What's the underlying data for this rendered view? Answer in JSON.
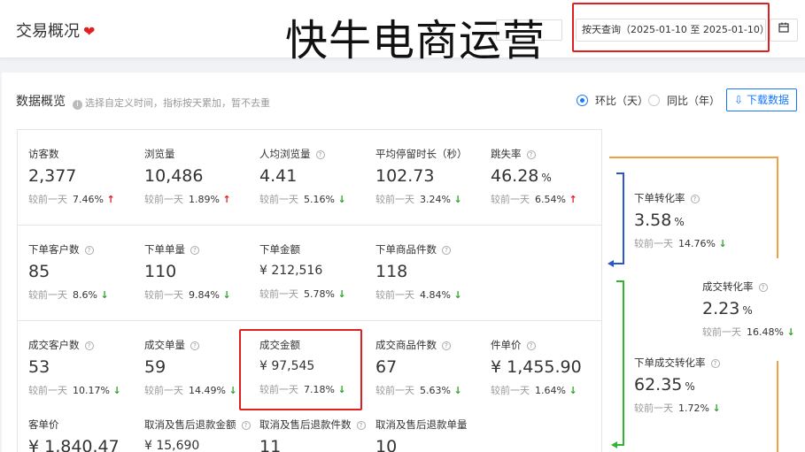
{
  "header": {
    "title": "交易概况",
    "watermark": "快牛电商运营",
    "date_button": "按天查询（2025-01-10 至 2025-01-10）",
    "calendar_icon": "calendar-icon"
  },
  "overview": {
    "title": "数据概览",
    "hint": "选择自定义时间，指标按天累加，暂不去重",
    "radio_day": "环比（天）",
    "radio_year": "同比（年）",
    "download": "下载数据"
  },
  "compare_label": "较前一天",
  "metrics": [
    {
      "label": "访客数",
      "help": false,
      "value": "2,377",
      "unit": "",
      "pct": "7.46%",
      "dir": "up"
    },
    {
      "label": "浏览量",
      "help": false,
      "value": "10,486",
      "unit": "",
      "pct": "1.89%",
      "dir": "up"
    },
    {
      "label": "人均浏览量",
      "help": true,
      "value": "4.41",
      "unit": "",
      "pct": "5.16%",
      "dir": "down"
    },
    {
      "label": "平均停留时长（秒）",
      "help": false,
      "value": "102.73",
      "unit": "",
      "pct": "3.24%",
      "dir": "down"
    },
    {
      "label": "跳失率",
      "help": true,
      "value": "46.28",
      "unit": "%",
      "pct": "6.54%",
      "dir": "up"
    },
    {
      "label": "下单客户数",
      "help": true,
      "value": "85",
      "unit": "",
      "pct": "8.6%",
      "dir": "down"
    },
    {
      "label": "下单单量",
      "help": true,
      "value": "110",
      "unit": "",
      "pct": "9.84%",
      "dir": "down"
    },
    {
      "label": "下单金额",
      "help": false,
      "value": "¥ 212,516",
      "unit": "",
      "pct": "5.78%",
      "dir": "down",
      "small": true
    },
    {
      "label": "下单商品件数",
      "help": true,
      "value": "118",
      "unit": "",
      "pct": "4.84%",
      "dir": "down"
    },
    {
      "label": "成交客户数",
      "help": true,
      "value": "53",
      "unit": "",
      "pct": "10.17%",
      "dir": "down"
    },
    {
      "label": "成交单量",
      "help": true,
      "value": "59",
      "unit": "",
      "pct": "14.49%",
      "dir": "down"
    },
    {
      "label": "成交金额",
      "help": false,
      "value": "¥ 97,545",
      "unit": "",
      "pct": "7.18%",
      "dir": "down",
      "small": true
    },
    {
      "label": "成交商品件数",
      "help": true,
      "value": "67",
      "unit": "",
      "pct": "5.63%",
      "dir": "down"
    },
    {
      "label": "件单价",
      "help": true,
      "value": "¥ 1,455.90",
      "unit": "",
      "pct": "1.64%",
      "dir": "down"
    },
    {
      "label": "客单价",
      "help": false,
      "value": "¥ 1,840.47",
      "unit": ""
    },
    {
      "label": "取消及售后退款金额",
      "help": true,
      "value": "¥ 15,690",
      "unit": "",
      "small": true
    },
    {
      "label": "取消及售后退款件数",
      "help": true,
      "value": "11",
      "unit": ""
    },
    {
      "label": "取消及售后退款单量",
      "help": false,
      "value": "10",
      "unit": ""
    }
  ],
  "flow": [
    {
      "label": "下单转化率",
      "value": "3.58",
      "unit": "%",
      "pct": "14.76%",
      "dir": "down"
    },
    {
      "label": "成交转化率",
      "value": "2.23",
      "unit": "%",
      "pct": "16.48%",
      "dir": "down"
    },
    {
      "label": "下单成交转化率",
      "value": "62.35",
      "unit": "%",
      "pct": "1.72%",
      "dir": "down"
    }
  ],
  "colors": {
    "up": "#e02020",
    "down": "#2ca52c",
    "accent": "#1677ff",
    "orange": "#f0a040",
    "blue_flow": "#2b55c8",
    "green_flow": "#33b433"
  }
}
